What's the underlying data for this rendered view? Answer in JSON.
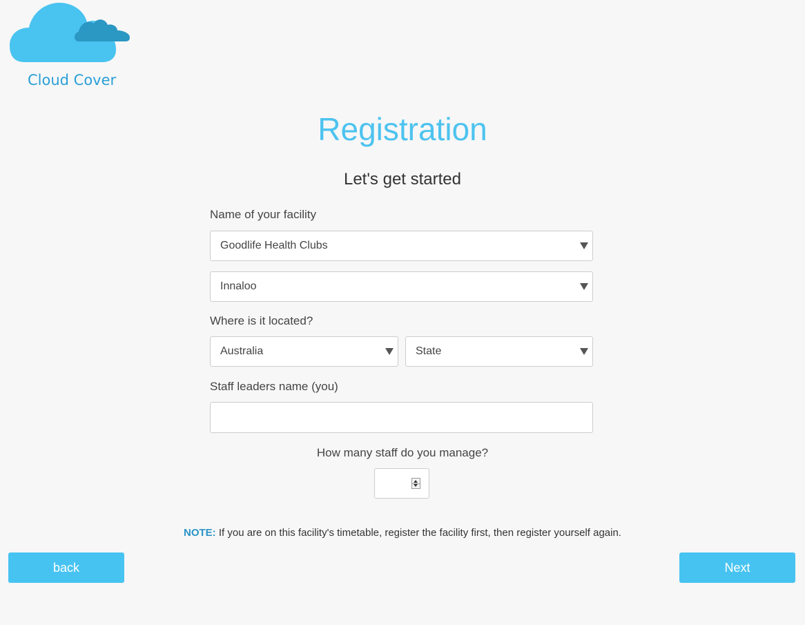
{
  "brand": {
    "name": "Cloud Cover",
    "colors": {
      "cloud_light": "#49c3f0",
      "cloud_dark": "#2b97c3",
      "text": "#2a9fd6"
    }
  },
  "page": {
    "title": "Registration",
    "subtitle": "Let's get started"
  },
  "form": {
    "facility_label": "Name of your facility",
    "facility_select": "Goodlife Health Clubs",
    "branch_select": "Innaloo",
    "location_label": "Where is it located?",
    "country_select": "Australia",
    "state_select": "State",
    "leader_label": "Staff leaders name (you)",
    "leader_value": "",
    "staff_count_label": "How many staff do you manage?",
    "staff_count_value": ""
  },
  "note": {
    "prefix": "NOTE:",
    "text": " If you are on this facility's timetable, register the facility first, then register yourself again."
  },
  "buttons": {
    "back": "back",
    "next": "Next"
  },
  "colors": {
    "accent": "#47c3f1",
    "title": "#4dc3ef",
    "background": "#f7f7f7"
  }
}
